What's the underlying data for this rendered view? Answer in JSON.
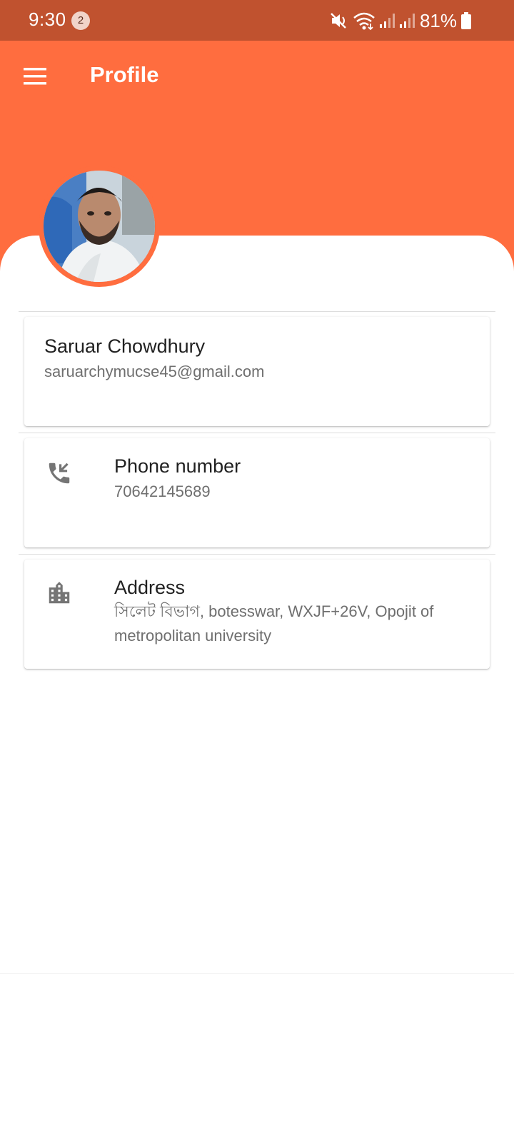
{
  "status_bar": {
    "time": "9:30",
    "notification_count": "2",
    "battery": "81%",
    "icons": [
      "mute-icon",
      "wifi-icon",
      "signal-icon",
      "signal-icon",
      "battery-icon"
    ]
  },
  "app_bar": {
    "title": "Profile",
    "menu_icon": "menu-icon"
  },
  "colors": {
    "status_bar": "#c0522f",
    "primary": "#ff6d3f",
    "icon_grey": "#757575"
  },
  "profile": {
    "name": "Saruar Chowdhury",
    "email": "saruarchymucse45@gmail.com"
  },
  "phone": {
    "label": "Phone number",
    "value": "70642145689",
    "icon": "phone-callback-icon"
  },
  "address": {
    "label": "Address",
    "value": "সিলেট বিভাগ, botesswar, WXJF+26V, Opojit of metropolitan university",
    "icon": "building-icon"
  }
}
